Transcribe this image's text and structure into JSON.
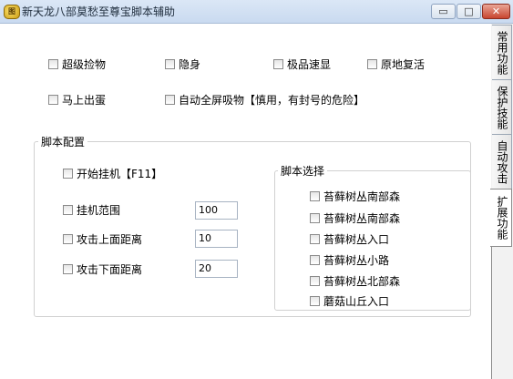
{
  "window": {
    "title": "新天龙八部莫愁至尊宝脚本辅助",
    "icon_label": "图",
    "minimize": "▭",
    "maximize": "□",
    "close": "✕"
  },
  "options": [
    {
      "label": "超级捡物"
    },
    {
      "label": "隐身"
    },
    {
      "label": "极品速显"
    },
    {
      "label": "原地复活"
    },
    {
      "label": "马上出蛋"
    },
    {
      "label": "自动全屏吸物【慎用，有封号的危险】"
    }
  ],
  "script_config": {
    "title": "脚本配置",
    "start_hang": "开始挂机【F11】",
    "hang_range": {
      "label": "挂机范围",
      "value": "100"
    },
    "attack_up": {
      "label": "攻击上面距离",
      "value": "10"
    },
    "attack_down": {
      "label": "攻击下面距离",
      "value": "20"
    }
  },
  "script_select": {
    "title": "脚本选择",
    "items": [
      "苔藓树丛南部森",
      "苔藓树丛南部森",
      "苔藓树丛入口",
      "苔藓树丛小路",
      "苔藓树丛北部森",
      "蘑菇山丘入口"
    ]
  },
  "tabs": [
    "常用功能",
    "保护技能",
    "自动攻击",
    "扩展功能"
  ],
  "active_tab": "扩展功能"
}
